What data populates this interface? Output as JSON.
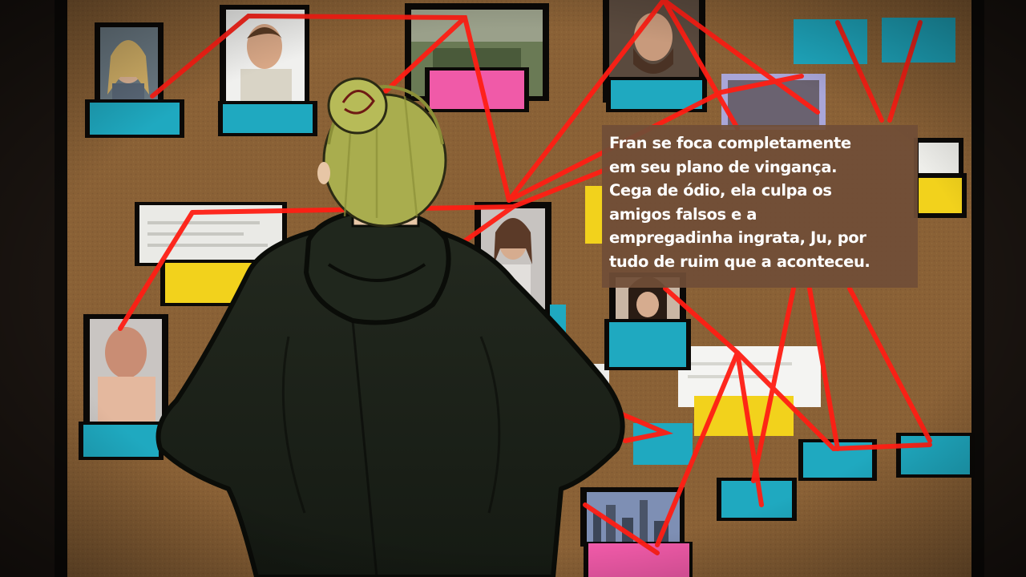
{
  "scene": {
    "description_visible": false,
    "colors": {
      "cork": "#8a6236",
      "string": "#ff1e14",
      "frame": "#0c0a08",
      "tag_blue": "#1fa9c0",
      "tag_pink": "#f05aa8",
      "tag_yellow": "#f2d21c",
      "caption_bg": "#704e37",
      "hair": "#a9ad4e",
      "hoodie": "#1a2018"
    },
    "icons": [
      "corkboard-icon",
      "photo-icon",
      "pin-icon"
    ]
  },
  "caption": {
    "text": "Fran se foca completamente\nem seu plano de vingança.\nCega de ódio, ela culpa os\namigos falsos e a\nempregadinha ingrata, Ju, por\ntudo de ruim que a aconteceu."
  }
}
